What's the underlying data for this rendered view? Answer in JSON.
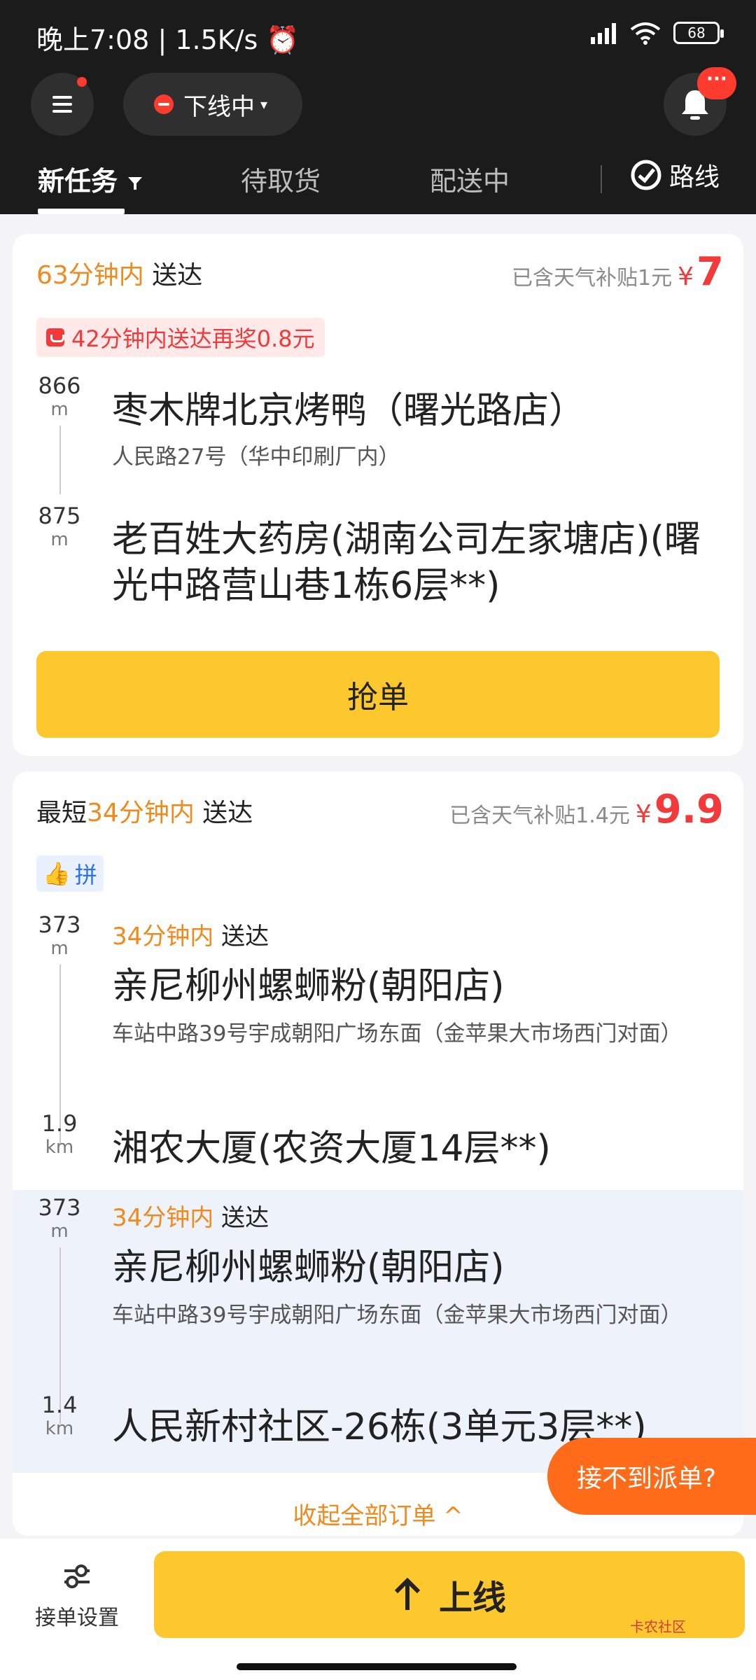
{
  "status": {
    "time": "晚上7:08",
    "speed": "1.5K/s",
    "battery": "68"
  },
  "topbar": {
    "state_label": "下线中",
    "bell_badge": "···"
  },
  "tabs": [
    "新任务",
    "待取货",
    "配送中"
  ],
  "route_label": "路线",
  "order1": {
    "time_prefix": "63分钟内",
    "time_suffix": "送达",
    "subsidy": "已含天气补贴1元",
    "currency": "¥",
    "price": "7",
    "reward": "42分钟内送达再奖0.8元",
    "pickup_dist": "866",
    "pickup_unit": "m",
    "pickup_name": "枣木牌北京烤鸭（曙光路店）",
    "pickup_addr": "人民路27号（华中印刷厂内）",
    "drop_dist": "875",
    "drop_unit": "m",
    "drop_name": "老百姓大药房(湖南公司左家塘店)(曙光中路营山巷1栋6层**)",
    "grab_label": "抢单"
  },
  "order2": {
    "prefix": "最短",
    "time": "34分钟内",
    "suffix": "送达",
    "subsidy": "已含天气补贴1.4元",
    "currency": "¥",
    "price": "9.9",
    "combo_tag": "拼",
    "sub1": {
      "dist": "373",
      "unit": "m",
      "time": "34分钟内",
      "suffix": "送达",
      "pickup_name": "亲尼柳州螺蛳粉(朝阳店)",
      "pickup_addr": "车站中路39号宇成朝阳广场东面（金苹果大市场西门对面）",
      "drop_dist": "1.9",
      "drop_unit": "km",
      "drop_name": "湘农大厦(农资大厦14层**)"
    },
    "sub2": {
      "dist": "373",
      "unit": "m",
      "time": "34分钟内",
      "suffix": "送达",
      "pickup_name": "亲尼柳州螺蛳粉(朝阳店)",
      "pickup_addr": "车站中路39号宇成朝阳广场东面（金苹果大市场西门对面）",
      "drop_dist": "1.4",
      "drop_unit": "km",
      "drop_name": "人民新村社区-26栋(3单元3层**)"
    },
    "collapse_label": "收起全部订单 ^"
  },
  "float_help": "接不到派单?",
  "bottom": {
    "settings_label": "接单设置",
    "online_label": "上线",
    "watermark": "卡农社区"
  },
  "colors": {
    "accent_yellow": "#fdc82d",
    "time_orange": "#f08a1c",
    "price_red": "#f23a3a",
    "header_bg": "#1b1b1b"
  }
}
